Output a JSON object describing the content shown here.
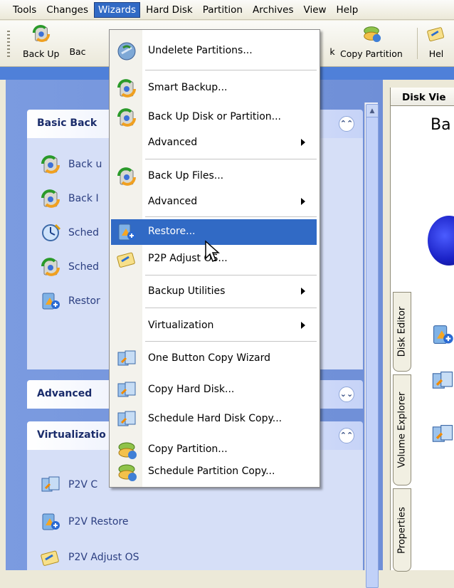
{
  "menubar": {
    "items": [
      "Tools",
      "Changes",
      "Wizards",
      "Hard Disk",
      "Partition",
      "Archives",
      "View",
      "Help"
    ]
  },
  "toolbar": {
    "back_up": "Back Up",
    "back_partial": "Bac",
    "k_partial": "k",
    "copy_partition": "Copy Partition",
    "help_partial": "Hel"
  },
  "leftpane": {
    "basic_title": "Basic Back",
    "basic_tasks": [
      "Back u",
      "Back I",
      "Sched",
      "Sched",
      "Restor"
    ],
    "advanced_title": "Advanced",
    "virtualization_title": "Virtualizatio",
    "virt_tasks": [
      "P2V C",
      "P2V Restore",
      "P2V Adjust OS"
    ]
  },
  "rightpane": {
    "tab_title": "Disk Vie",
    "big_title": "Ba",
    "vtabs": [
      "Disk Editor",
      "Volume Explorer",
      "Properties"
    ]
  },
  "wizards_menu": {
    "items": [
      {
        "label": "Undelete Partitions...",
        "icon": "undelete-icon"
      },
      {
        "label": "Smart Backup...",
        "icon": "smart-backup-icon"
      },
      {
        "label": "Back Up Disk or Partition...",
        "icon": "backup-disk-icon"
      },
      {
        "label": "Advanced",
        "icon": ""
      },
      {
        "label": "Back Up Files...",
        "icon": "backup-files-icon"
      },
      {
        "label": "Advanced",
        "icon": ""
      },
      {
        "label": "Restore...",
        "icon": "restore-icon"
      },
      {
        "label": "P2P Adjust OS...",
        "icon": "p2p-adjust-icon"
      },
      {
        "label": "Backup Utilities",
        "icon": ""
      },
      {
        "label": "Virtualization",
        "icon": ""
      },
      {
        "label": "One Button Copy Wizard",
        "icon": "one-button-copy-icon"
      },
      {
        "label": "Copy Hard Disk...",
        "icon": "copy-hard-disk-icon"
      },
      {
        "label": "Schedule Hard Disk Copy...",
        "icon": "schedule-disk-copy-icon"
      },
      {
        "label": "Copy Partition...",
        "icon": "copy-partition-icon"
      },
      {
        "label": "Schedule Partition Copy...",
        "icon": "schedule-partition-copy-icon"
      }
    ],
    "highlight_color": "#316ac5"
  }
}
